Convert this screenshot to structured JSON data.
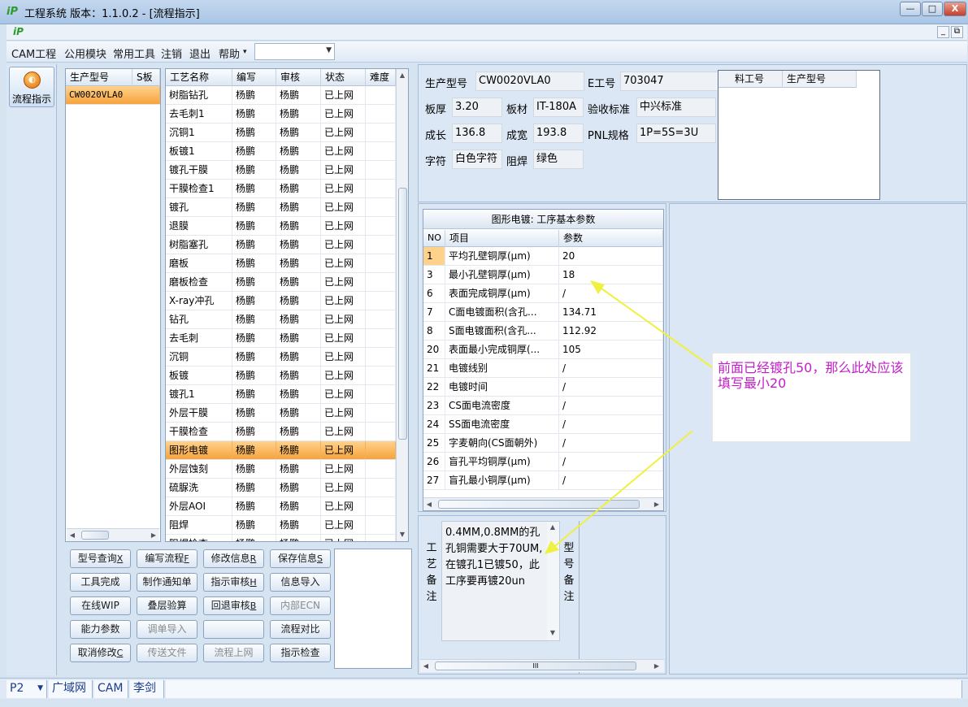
{
  "window": {
    "title": "工程系统  版本：1.1.0.2 - [流程指示]",
    "controls": {
      "minimize": "—",
      "maximize": "□",
      "close": "X"
    },
    "mdi_controls": {
      "minimize": "_",
      "restore": "⧉"
    }
  },
  "menu": {
    "items": [
      "CAM工程",
      "公用模块",
      "常用工具",
      "注销",
      "退出",
      "帮助"
    ],
    "help_arrow": "▾",
    "combo_value": ""
  },
  "nav": {
    "flow_label": "流程指示",
    "icon": "flow-icon"
  },
  "product_grid": {
    "headers": [
      "生产型号",
      "S板"
    ],
    "rows": [
      {
        "model": "CW0020VLA0",
        "s": ""
      }
    ]
  },
  "process_grid": {
    "headers": [
      "工艺名称",
      "编写",
      "审核",
      "状态",
      "难度"
    ],
    "selected_index": 19,
    "rows": [
      [
        "树脂钻孔",
        "杨鹏",
        "杨鹏",
        "已上网",
        ""
      ],
      [
        "去毛刺1",
        "杨鹏",
        "杨鹏",
        "已上网",
        ""
      ],
      [
        "沉铜1",
        "杨鹏",
        "杨鹏",
        "已上网",
        ""
      ],
      [
        "板镀1",
        "杨鹏",
        "杨鹏",
        "已上网",
        ""
      ],
      [
        "镀孔干膜",
        "杨鹏",
        "杨鹏",
        "已上网",
        ""
      ],
      [
        "干膜检查1",
        "杨鹏",
        "杨鹏",
        "已上网",
        ""
      ],
      [
        "镀孔",
        "杨鹏",
        "杨鹏",
        "已上网",
        ""
      ],
      [
        "退膜",
        "杨鹏",
        "杨鹏",
        "已上网",
        ""
      ],
      [
        "树脂塞孔",
        "杨鹏",
        "杨鹏",
        "已上网",
        ""
      ],
      [
        "磨板",
        "杨鹏",
        "杨鹏",
        "已上网",
        ""
      ],
      [
        "磨板检查",
        "杨鹏",
        "杨鹏",
        "已上网",
        ""
      ],
      [
        "X-ray冲孔",
        "杨鹏",
        "杨鹏",
        "已上网",
        ""
      ],
      [
        "钻孔",
        "杨鹏",
        "杨鹏",
        "已上网",
        ""
      ],
      [
        "去毛刺",
        "杨鹏",
        "杨鹏",
        "已上网",
        ""
      ],
      [
        "沉铜",
        "杨鹏",
        "杨鹏",
        "已上网",
        ""
      ],
      [
        "板镀",
        "杨鹏",
        "杨鹏",
        "已上网",
        ""
      ],
      [
        "镀孔1",
        "杨鹏",
        "杨鹏",
        "已上网",
        ""
      ],
      [
        "外层干膜",
        "杨鹏",
        "杨鹏",
        "已上网",
        ""
      ],
      [
        "干膜检查",
        "杨鹏",
        "杨鹏",
        "已上网",
        ""
      ],
      [
        "图形电镀",
        "杨鹏",
        "杨鹏",
        "已上网",
        ""
      ],
      [
        "外层蚀刻",
        "杨鹏",
        "杨鹏",
        "已上网",
        ""
      ],
      [
        "硫脲洗",
        "杨鹏",
        "杨鹏",
        "已上网",
        ""
      ],
      [
        "外层AOI",
        "杨鹏",
        "杨鹏",
        "已上网",
        ""
      ],
      [
        "阻焊",
        "杨鹏",
        "杨鹏",
        "已上网",
        ""
      ],
      [
        "阻焊检查",
        "杨鹏",
        "杨鹏",
        "已上网",
        ""
      ]
    ]
  },
  "buttons": [
    [
      {
        "label": "型号查询",
        "key": "X",
        "enabled": true
      },
      {
        "label": "编写流程",
        "key": "F",
        "enabled": true
      },
      {
        "label": "修改信息",
        "key": "R",
        "enabled": true
      },
      {
        "label": "保存信息",
        "key": "S",
        "enabled": true
      }
    ],
    [
      {
        "label": "工具完成",
        "key": "",
        "enabled": true
      },
      {
        "label": "制作通知单",
        "key": "",
        "enabled": true
      },
      {
        "label": "指示审核",
        "key": "H",
        "enabled": true
      },
      {
        "label": "信息导入",
        "key": "",
        "enabled": true
      }
    ],
    [
      {
        "label": "在线WIP",
        "key": "",
        "enabled": true
      },
      {
        "label": "叠层验算",
        "key": "",
        "enabled": true
      },
      {
        "label": "回退审核",
        "key": "B",
        "enabled": true
      },
      {
        "label": "内部ECN",
        "key": "",
        "enabled": false
      }
    ],
    [
      {
        "label": "能力参数",
        "key": "",
        "enabled": true
      },
      {
        "label": "调单导入",
        "key": "",
        "enabled": false
      },
      {
        "label": "",
        "key": "",
        "enabled": true
      },
      {
        "label": "流程对比",
        "key": "",
        "enabled": true
      }
    ],
    [
      {
        "label": "取消修改",
        "key": "C",
        "enabled": true
      },
      {
        "label": "传送文件",
        "key": "",
        "enabled": false
      },
      {
        "label": "流程上网",
        "key": "",
        "enabled": false
      },
      {
        "label": "指示检查",
        "key": "",
        "enabled": true
      }
    ]
  ],
  "info": {
    "model_label": "生产型号",
    "model": "CW0020VLA0",
    "e_label": "E工号",
    "e_no": "703047",
    "thickness_label": "板厚",
    "thickness": "3.20",
    "material_label": "板材",
    "material": "IT-180A",
    "standard_label": "验收标准",
    "standard": "中兴标准",
    "length_label": "成长",
    "length": "136.8",
    "width_label": "成宽",
    "width": "193.8",
    "pnl_label": "PNL规格",
    "pnl": "1P=5S=3U",
    "char_label": "字符",
    "char": "白色字符",
    "mask_label": "阻焊",
    "mask": "绿色",
    "sub_headers": [
      "料工号",
      "生产型号"
    ]
  },
  "params": {
    "title": "图形电镀: 工序基本参数",
    "headers": [
      "NO",
      "项目",
      "参数"
    ],
    "rows": [
      [
        "1",
        "平均孔壁铜厚(μm)",
        "20"
      ],
      [
        "3",
        "最小孔壁铜厚(μm)",
        "18"
      ],
      [
        "6",
        "表面完成铜厚(μm)",
        "/"
      ],
      [
        "7",
        "C面电镀面积(含孔...",
        "134.71"
      ],
      [
        "8",
        "S面电镀面积(含孔...",
        "112.92"
      ],
      [
        "20",
        "表面最小完成铜厚(...",
        "105"
      ],
      [
        "21",
        "电镀线别",
        "/"
      ],
      [
        "22",
        "电镀时间",
        "/"
      ],
      [
        "23",
        "CS面电流密度",
        "/"
      ],
      [
        "24",
        "SS面电流密度",
        "/"
      ],
      [
        "25",
        "字麦朝向(CS面朝外)",
        "/"
      ],
      [
        "26",
        "盲孔平均铜厚(μm)",
        "/"
      ],
      [
        "27",
        "盲孔最小铜厚(μm)",
        "/"
      ]
    ]
  },
  "remark": {
    "label_chars": [
      "工",
      "艺",
      "备",
      "注"
    ],
    "text": "0.4MM,0.8MM的孔孔铜需要大于70UM,在镀孔1已镀50，此工序要再镀20un",
    "model_label_chars": [
      "型",
      "号",
      "备",
      "注"
    ],
    "scroll_mark": "III"
  },
  "annotation": {
    "text": "前面已经镀孔50，那么此处应该填写最小20",
    "color": "#c11ec9"
  },
  "status": {
    "items": [
      "P2",
      "广域网",
      "CAM",
      "李剑"
    ]
  },
  "colors": {
    "selection": "#f6a33c",
    "arrow": "#f0f040",
    "window_bg": "#d6e3f1"
  }
}
